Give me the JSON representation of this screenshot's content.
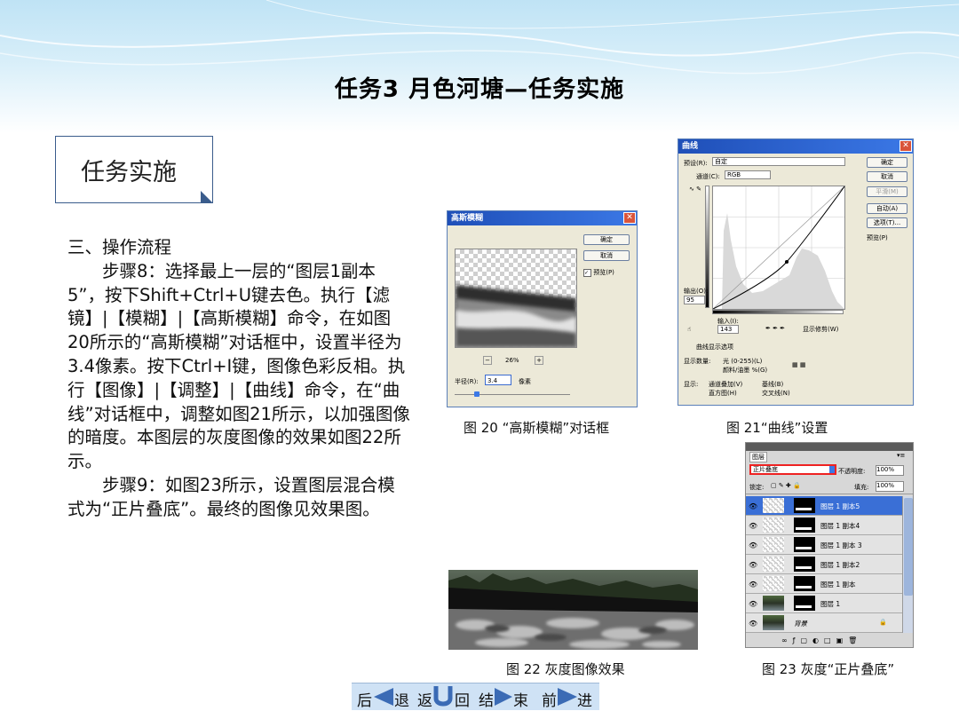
{
  "title": "任务3   月色河塘—任务实施",
  "task_box": "任务实施",
  "body": {
    "heading": "三、操作流程",
    "step8": "步骤8：选择最上一层的“图层1副本5”，按下Shift+Ctrl+U键去色。执行【滤镜】|【模糊】|【高斯模糊】命令，在如图20所示的“高斯模糊”对话框中，设置半径为3.4像素。按下Ctrl+I键，图像色彩反相。执行【图像】|【调整】|【曲线】命令，在“曲线”对话框中，调整如图21所示，以加强图像的暗度。本图层的灰度图像的效果如图22所示。",
    "step9": "步骤9：如图23所示，设置图层混合模式为“正片叠底”。最终的图像见效果图。"
  },
  "gauss_dialog": {
    "title": "高斯模糊",
    "ok": "确定",
    "cancel": "取消",
    "preview": "预览(P)",
    "zoom": "26%",
    "radius_label": "半径(R):",
    "radius_value": "3.4",
    "unit": "像素"
  },
  "curves_dialog": {
    "title": "曲线",
    "preset_label": "预设(R):",
    "preset_value": "自定",
    "channel_label": "通道(C):",
    "channel_value": "RGB",
    "buttons": [
      "确定",
      "取消",
      "平滑(M)",
      "自动(A)",
      "选项(T)..."
    ],
    "preview": "预览(P)",
    "output_label": "输出(O):",
    "output_value": "95",
    "input_label": "输入(I):",
    "input_value": "143",
    "clip": "显示修剪(W)",
    "display_opts": "曲线显示选项",
    "show_amount": "显示数量:",
    "light": "光 (0-255)(L)",
    "pigment": "颜料/油墨 %(G)",
    "show": "显示:",
    "opts": [
      "通道叠加(V)",
      "基线(B)",
      "直方图(H)",
      "交叉线(N)"
    ]
  },
  "layers_panel": {
    "tab": "图层",
    "blend_mode": "正片叠底",
    "opacity_label": "不透明度:",
    "opacity": "100%",
    "lock_label": "锁定:",
    "fill_label": "填充:",
    "fill": "100%",
    "layers": [
      "图层 1 副本5",
      "图层 1 副本4",
      "图层 1 副本 3",
      "图层 1 副本2",
      "图层 1 副本",
      "图层 1",
      "背景"
    ]
  },
  "captions": {
    "fig20": "图 20 “高斯模糊”对话框",
    "fig21": "图 21“曲线”设置",
    "fig22": "图 22   灰度图像效果",
    "fig23": "图 23   灰度“正片叠底”"
  },
  "nav": {
    "back": [
      "后",
      "退"
    ],
    "return": [
      "返",
      "回"
    ],
    "end": [
      "结",
      "束"
    ],
    "forward": [
      "前",
      "进"
    ]
  },
  "colors": {
    "title_bar": "#1f4fb8",
    "panel_border": "#3a5c8c",
    "nav_bg": "#cfe2f5",
    "selected_layer": "#3a6fd6"
  }
}
